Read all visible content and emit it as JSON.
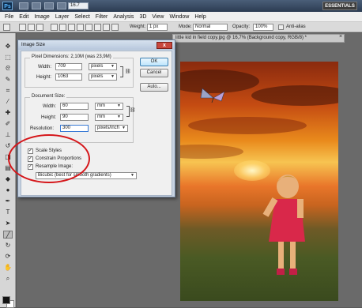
{
  "app": {
    "logo": "Ps",
    "zoom": "16.7",
    "workspace": "ESSENTIALS"
  },
  "menu": [
    "File",
    "Edit",
    "Image",
    "Layer",
    "Select",
    "Filter",
    "Analysis",
    "3D",
    "View",
    "Window",
    "Help"
  ],
  "options": {
    "weight_label": "Weight:",
    "weight_value": "1 px",
    "mode_label": "Mode:",
    "mode_value": "Normal",
    "opacity_label": "Opacity:",
    "opacity_value": "100%",
    "antialias_label": "Anti-alias"
  },
  "document": {
    "tab_title": "little kid in field copy.jpg @ 16,7% (Background copy, RGB/8) *",
    "close_glyph": "×"
  },
  "dialog": {
    "title": "Image Size",
    "close_glyph": "x",
    "pixel_dimensions": {
      "title": "Pixel Dimensions: 2,10M (was 23,9M)",
      "width_label": "Width:",
      "width_value": "709",
      "width_unit": "pixels",
      "height_label": "Height:",
      "height_value": "1063",
      "height_unit": "pixels"
    },
    "document_size": {
      "title": "Document Size:",
      "width_label": "Width:",
      "width_value": "60",
      "width_unit": "mm",
      "height_label": "Height:",
      "height_value": "90",
      "height_unit": "mm",
      "resolution_label": "Resolution:",
      "resolution_value": "300",
      "resolution_unit": "pixels/inch"
    },
    "checkboxes": [
      {
        "label": "Scale Styles",
        "checked": true
      },
      {
        "label": "Constrain Proportions",
        "checked": true
      },
      {
        "label": "Resample Image:",
        "checked": true
      }
    ],
    "resample_method": "Bicubic (best for smooth gradients)",
    "buttons": {
      "ok": "OK",
      "cancel": "Cancel",
      "auto": "Auto..."
    }
  },
  "annotation": {
    "color": "#d5161a"
  }
}
